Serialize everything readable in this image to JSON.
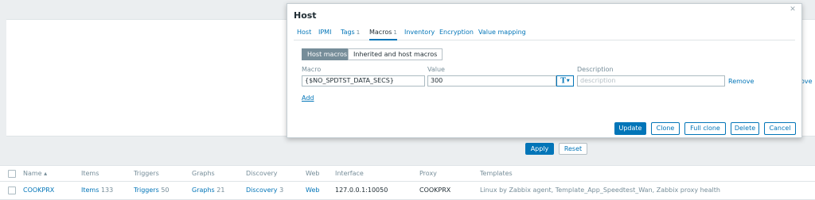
{
  "background": {
    "remove_partial": "ove",
    "filter": {
      "apply_label": "Apply",
      "reset_label": "Reset"
    },
    "table": {
      "headers": {
        "name": "Name ▴",
        "items": "Items",
        "triggers": "Triggers",
        "graphs": "Graphs",
        "discovery": "Discovery",
        "web": "Web",
        "interface": "Interface",
        "proxy": "Proxy",
        "templates": "Templates"
      },
      "row": {
        "name": "COOKPRX",
        "items_label": "Items",
        "items_count": "133",
        "triggers_label": "Triggers",
        "triggers_count": "50",
        "graphs_label": "Graphs",
        "graphs_count": "21",
        "discovery_label": "Discovery",
        "discovery_count": "3",
        "web": "Web",
        "interface": "127.0.0.1:10050",
        "proxy": "COOKPRX",
        "templates": "Linux by Zabbix agent, Template_App_Speedtest_Wan, Zabbix proxy health"
      }
    }
  },
  "modal": {
    "title": "Host",
    "close_icon": "close-icon",
    "tabs": [
      {
        "label": "Host",
        "count": ""
      },
      {
        "label": "IPMI",
        "count": ""
      },
      {
        "label": "Tags",
        "count": "1"
      },
      {
        "label": "Macros",
        "count": "1"
      },
      {
        "label": "Inventory",
        "count": ""
      },
      {
        "label": "Encryption",
        "count": ""
      },
      {
        "label": "Value mapping",
        "count": ""
      }
    ],
    "subtabs": {
      "host_macros": "Host macros",
      "inherited": "Inherited and host macros"
    },
    "columns": {
      "macro": "Macro",
      "value": "Value",
      "description": "Description"
    },
    "macro_row": {
      "macro": "{$NO_SPDTST_DATA_SECS}",
      "value": "300",
      "type_icon": "T",
      "description_placeholder": "description",
      "remove_label": "Remove"
    },
    "add_label": "Add",
    "buttons": {
      "update": "Update",
      "clone": "Clone",
      "full_clone": "Full clone",
      "delete": "Delete",
      "cancel": "Cancel"
    }
  },
  "colors": {
    "accent": "#0275b8",
    "muted": "#768d99",
    "background": "#ebeef0"
  }
}
